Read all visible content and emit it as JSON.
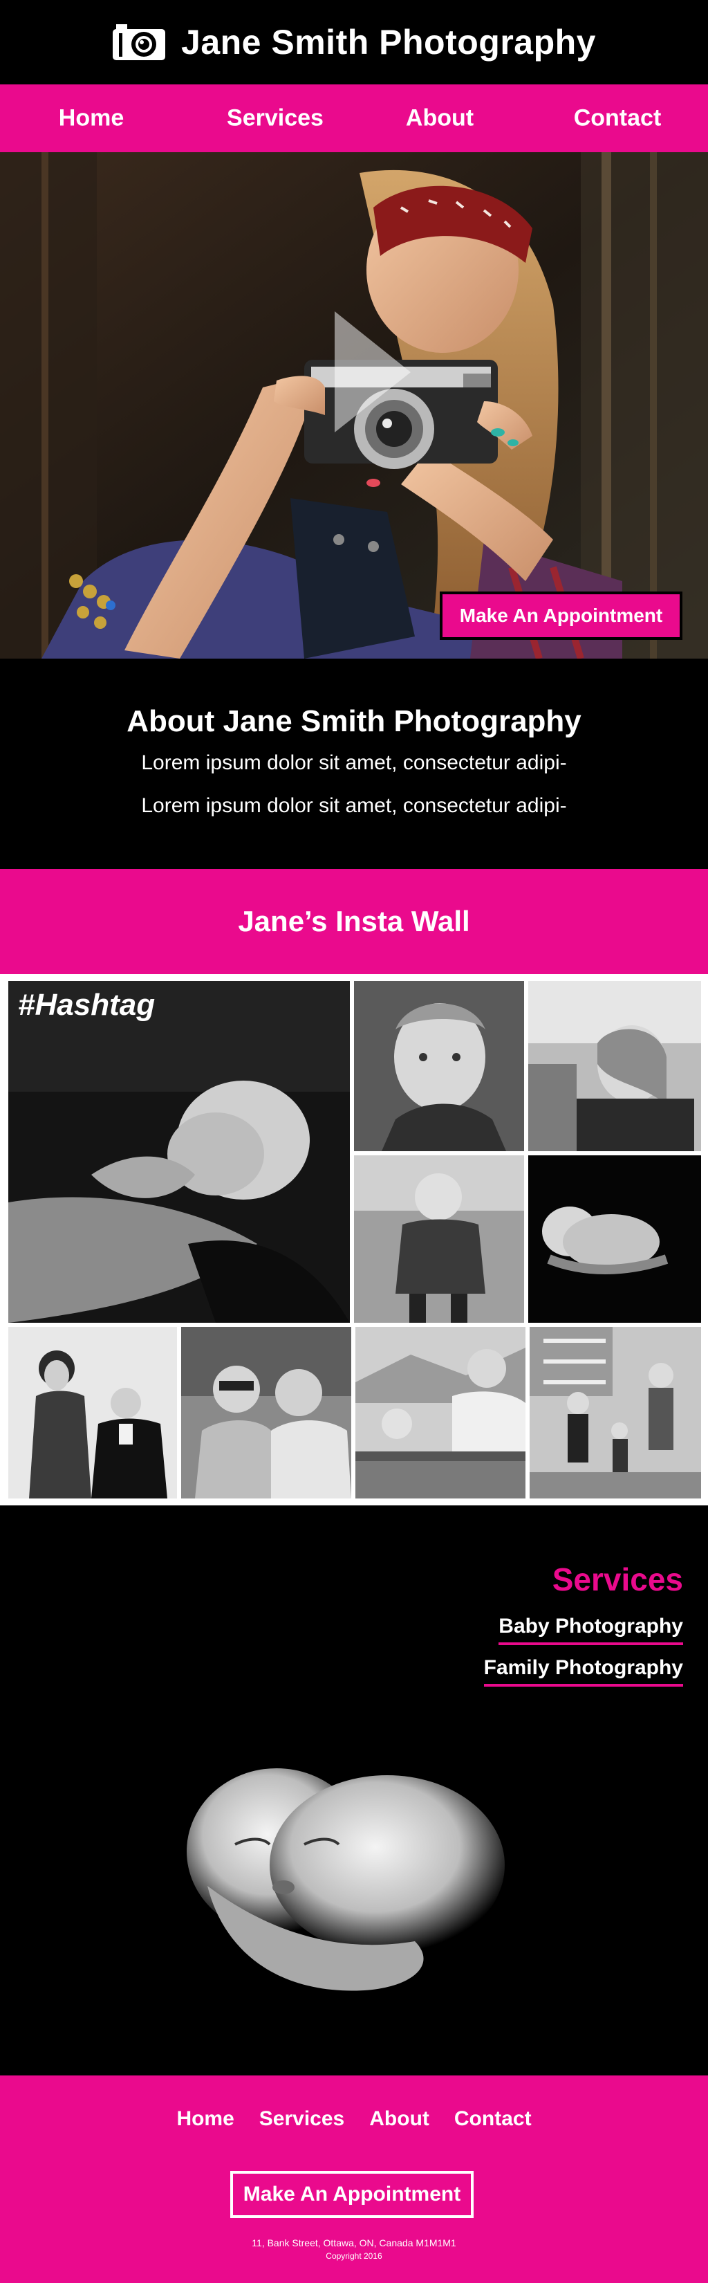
{
  "header": {
    "title": "Jane Smith Photography",
    "logo_icon": "camera-icon"
  },
  "nav": {
    "items": [
      {
        "label": "Home"
      },
      {
        "label": "Services"
      },
      {
        "label": "About"
      },
      {
        "label": "Contact"
      }
    ]
  },
  "hero": {
    "cta_label": "Make An Appointment",
    "play_icon": "play-icon"
  },
  "about": {
    "title": "About Jane Smith Photography",
    "paragraphs": [
      "Lorem ipsum dolor sit amet, consectetur adipi-",
      "Lorem ipsum dolor sit amet, consectetur adipi-"
    ]
  },
  "insta": {
    "title": "Jane’s Insta Wall",
    "hashtag": "#Hashtag"
  },
  "services": {
    "title": "Services",
    "items": [
      {
        "label": "Baby Photography"
      },
      {
        "label": "Family Photography"
      }
    ]
  },
  "footer": {
    "nav": [
      {
        "label": "Home"
      },
      {
        "label": "Services"
      },
      {
        "label": "About"
      },
      {
        "label": "Contact"
      }
    ],
    "cta_label": "Make An Appointment",
    "address": "11, Bank Street, Ottawa, ON, Canada     M1M1M1",
    "copyright": "Copyright 2016"
  },
  "colors": {
    "accent": "#ea0a8d",
    "background": "#000000",
    "text": "#ffffff"
  }
}
